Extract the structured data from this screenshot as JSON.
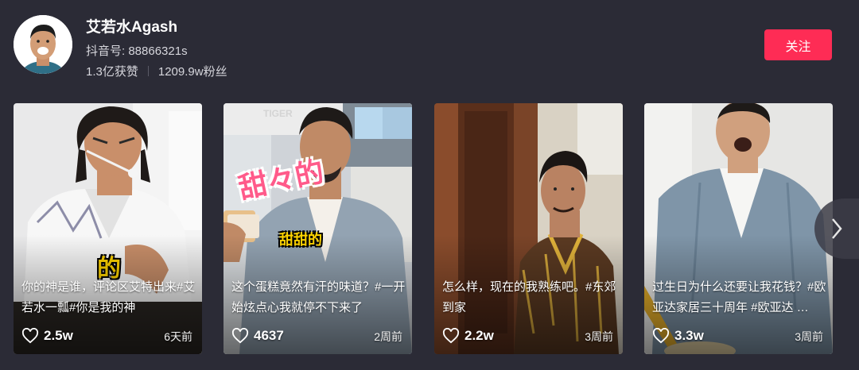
{
  "profile": {
    "name": "艾若水Agash",
    "douyin_id": "抖音号: 88866321s",
    "likes": "1.3亿获赞",
    "fans": "1209.9w粉丝",
    "follow_label": "关注"
  },
  "colors": {
    "accent": "#fe2c55",
    "background": "#2b2b36"
  },
  "videos": [
    {
      "caption": "你的神是谁，评论区艾特出来#艾若水一瓢#你是我的神",
      "likes": "2.5w",
      "date": "6天前",
      "sticker": "的"
    },
    {
      "caption": "这个蛋糕竟然有汗的味道？#一开始炫点心我就停不下来了",
      "likes": "4637",
      "date": "2周前",
      "sticker_pink": "甜々的",
      "sticker": "甜甜的",
      "store_sign": "TIGER"
    },
    {
      "caption": "怎么样，现在的我熟练吧。#东郊到家",
      "likes": "2.2w",
      "date": "3周前"
    },
    {
      "caption": "过生日为什么还要让我花钱？#欧亚达家居三十周年 #欧亚达 …",
      "likes": "3.3w",
      "date": "3周前"
    }
  ],
  "icons": {
    "like": "heart-icon",
    "next": "chevron-right-icon"
  }
}
